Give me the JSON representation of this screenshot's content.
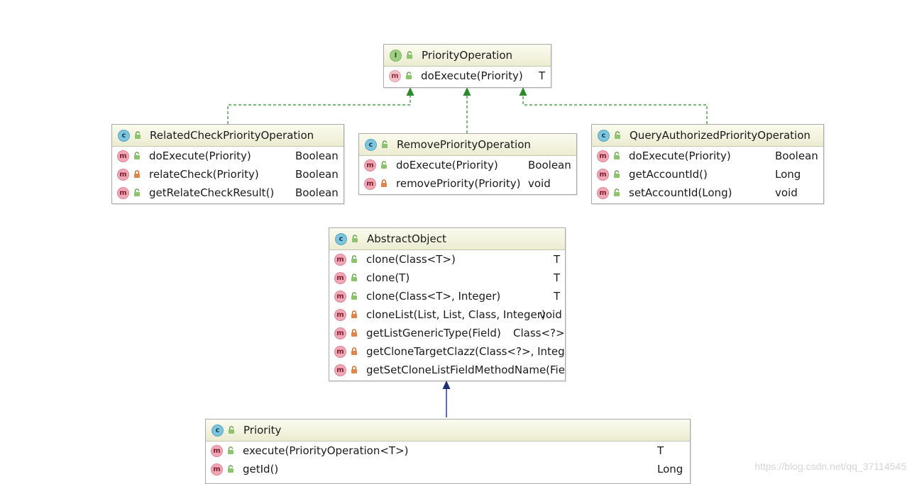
{
  "colors": {
    "implements_edge": "#2b8a2b",
    "extends_edge": "#1e2f78",
    "header_bg": "#ececd2",
    "class_badge": "#7ec4dc",
    "interface_badge": "#9fcf85",
    "method_badge": "#f1a7b4"
  },
  "badge_letters": {
    "class": "c",
    "interface": "I",
    "method": "m"
  },
  "icons": {
    "class": "class-icon",
    "interface": "interface-icon",
    "method": "method-icon",
    "public": "unlocked-padlock-icon",
    "private": "locked-padlock-icon"
  },
  "boxes": {
    "priority_operation": {
      "kind": "interface",
      "name": "PriorityOperation",
      "methods": [
        {
          "name": "doExecute(Priority)",
          "ret": "T",
          "vis": "public"
        }
      ]
    },
    "related_check": {
      "kind": "class",
      "name": "RelatedCheckPriorityOperation",
      "methods": [
        {
          "name": "doExecute(Priority)",
          "ret": "Boolean",
          "vis": "public"
        },
        {
          "name": "relateCheck(Priority)",
          "ret": "Boolean",
          "vis": "private"
        },
        {
          "name": "getRelateCheckResult()",
          "ret": "Boolean",
          "vis": "public"
        }
      ]
    },
    "remove_priority": {
      "kind": "class",
      "name": "RemovePriorityOperation",
      "methods": [
        {
          "name": "doExecute(Priority)",
          "ret": "Boolean",
          "vis": "public"
        },
        {
          "name": "removePriority(Priority)",
          "ret": "void",
          "vis": "private"
        }
      ]
    },
    "query_authorized": {
      "kind": "class",
      "name": "QueryAuthorizedPriorityOperation",
      "methods": [
        {
          "name": "doExecute(Priority)",
          "ret": "Boolean",
          "vis": "public"
        },
        {
          "name": "getAccountId()",
          "ret": "Long",
          "vis": "public"
        },
        {
          "name": "setAccountId(Long)",
          "ret": "void",
          "vis": "public"
        }
      ]
    },
    "abstract_object": {
      "kind": "class",
      "name": "AbstractObject",
      "methods": [
        {
          "name": "clone(Class<T>)",
          "ret": "T",
          "vis": "public"
        },
        {
          "name": "clone(T)",
          "ret": "T",
          "vis": "public"
        },
        {
          "name": "clone(Class<T>, Integer)",
          "ret": "T",
          "vis": "public"
        },
        {
          "name": "cloneList(List, List, Class, Integer)",
          "ret": "void",
          "vis": "private"
        },
        {
          "name": "getListGenericType(Field)",
          "ret": "Class<?>",
          "vis": "private"
        },
        {
          "name": "getCloneTargetClazz(Class<?>, Integer",
          "ret": "",
          "vis": "private"
        },
        {
          "name": "getSetCloneListFieldMethodName(Fiel",
          "ret": "",
          "vis": "private"
        }
      ]
    },
    "priority": {
      "kind": "class",
      "name": "Priority",
      "methods": [
        {
          "name": "execute(PriorityOperation<T>)",
          "ret": "T",
          "vis": "public"
        },
        {
          "name": "getId()",
          "ret": "Long",
          "vis": "public"
        }
      ]
    }
  },
  "relations": [
    {
      "from": "related_check",
      "to": "priority_operation",
      "type": "implements"
    },
    {
      "from": "remove_priority",
      "to": "priority_operation",
      "type": "implements"
    },
    {
      "from": "query_authorized",
      "to": "priority_operation",
      "type": "implements"
    },
    {
      "from": "priority",
      "to": "abstract_object",
      "type": "extends"
    }
  ],
  "watermark": "https://blog.csdn.net/qq_37114545"
}
